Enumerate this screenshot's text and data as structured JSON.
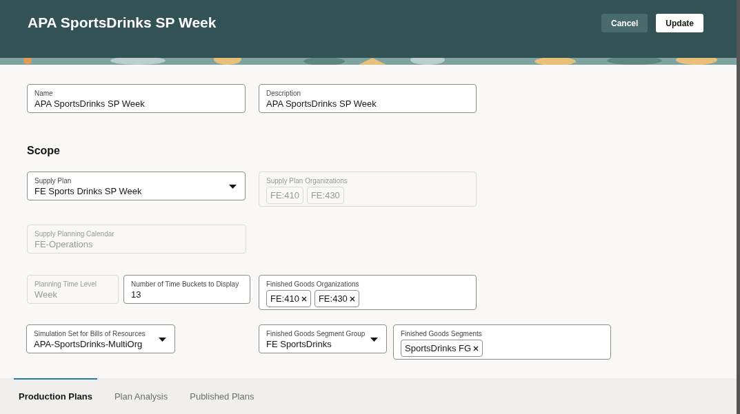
{
  "header": {
    "title": "APA SportsDrinks SP Week",
    "buttons": [
      {
        "label": "Cancel",
        "kind": "secondary"
      },
      {
        "label": "Update",
        "kind": "primary"
      }
    ]
  },
  "general_fields": [
    {
      "kind": "text",
      "label": "Name",
      "value": "APA SportsDrinks SP Week",
      "disabled": false
    },
    {
      "kind": "text",
      "label": "Description",
      "value": "APA SportsDrinks SP Week",
      "disabled": false
    }
  ],
  "scope": {
    "heading": "Scope",
    "fields": [
      {
        "kind": "select",
        "label": "Supply Plan",
        "value": "FE Sports Drinks SP Week",
        "disabled": false
      },
      {
        "kind": "chips",
        "label": "Supply Plan Organizations",
        "chips": [
          "FE:410",
          "FE:430"
        ],
        "disabled": true
      },
      {
        "kind": "text",
        "label": "Supply Planning Calendar",
        "value": "FE-Operations",
        "disabled": true
      },
      {
        "kind": "text",
        "label": "Planning Time Level",
        "value": "Week",
        "disabled": true
      },
      {
        "kind": "text",
        "label": "Number of Time Buckets to Display",
        "value": "13",
        "disabled": false
      },
      {
        "kind": "chips",
        "label": "Finished Goods Organizations",
        "chips": [
          "FE:410",
          "FE:430"
        ],
        "disabled": false
      },
      {
        "kind": "select",
        "label": "Simulation Set for Bills of Resources",
        "value": "APA-SportsDrinks-MultiOrg",
        "disabled": false
      },
      {
        "kind": "select",
        "label": "Finished Goods Segment Group",
        "value": "FE SportsDrinks",
        "disabled": false
      },
      {
        "kind": "chips",
        "label": "Finished Goods Segments",
        "chips": [
          "SportsDrinks FG"
        ],
        "disabled": false
      }
    ]
  },
  "tabs": [
    {
      "label": "Production Plans",
      "selected": true
    },
    {
      "label": "Plan Analysis",
      "selected": false
    },
    {
      "label": "Published Plans",
      "selected": false
    }
  ]
}
